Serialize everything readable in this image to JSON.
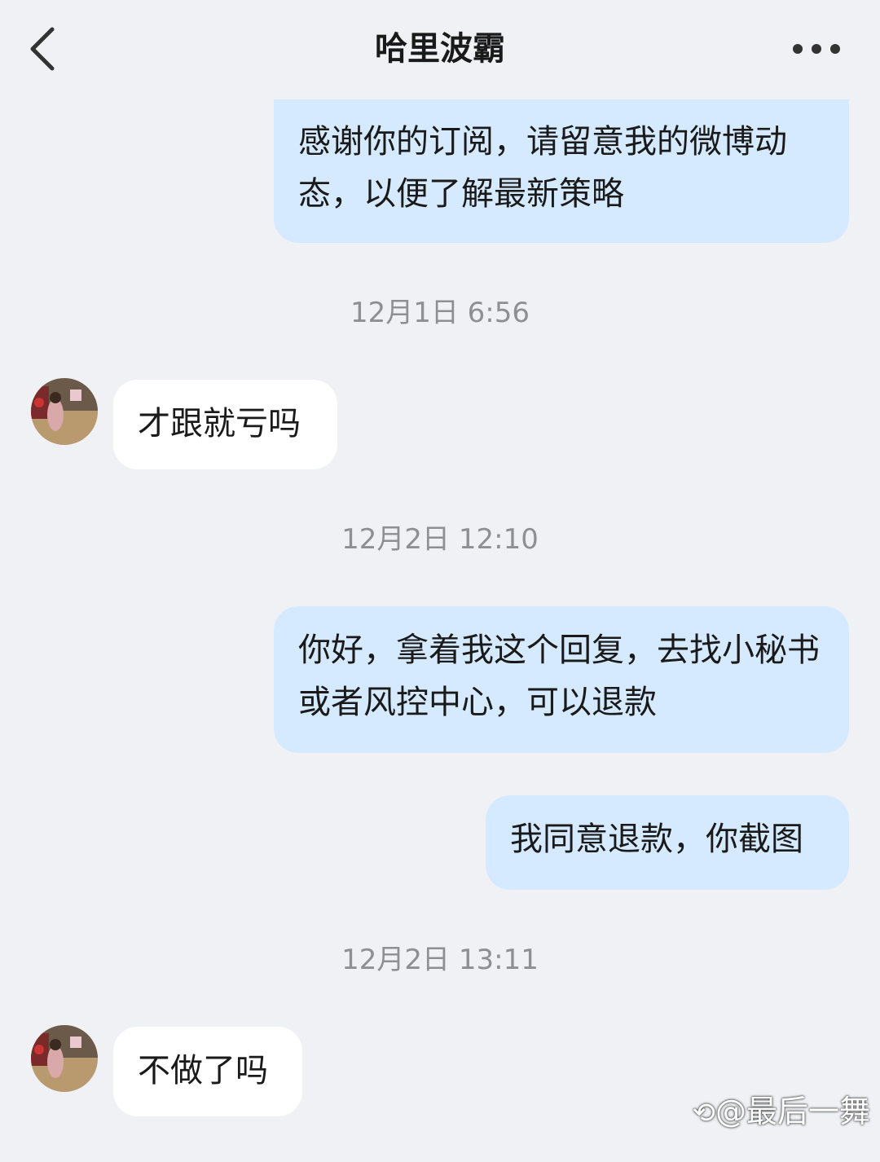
{
  "header": {
    "title": "哈里波霸",
    "back_icon": "chevron-left-icon",
    "more_icon": "more-dots-icon"
  },
  "messages": [
    {
      "type": "out",
      "text": "感谢你的订阅，请留意我的微博动态，以便了解最新策略"
    },
    {
      "type": "time",
      "text": "12月1日 6:56"
    },
    {
      "type": "in",
      "text": "才跟就亏吗"
    },
    {
      "type": "time",
      "text": "12月2日 12:10"
    },
    {
      "type": "out",
      "text": "你好，拿着我这个回复，去找小秘书或者风控中心，可以退款"
    },
    {
      "type": "out",
      "text": "我同意退款，你截图"
    },
    {
      "type": "time",
      "text": "12月2日 13:11"
    },
    {
      "type": "in",
      "text": "不做了吗"
    }
  ],
  "watermark": "@最后一舞",
  "colors": {
    "background": "#f0f1f5",
    "outgoing_bubble": "#d6eaff",
    "incoming_bubble": "#ffffff",
    "timestamp": "#8e8e93"
  }
}
